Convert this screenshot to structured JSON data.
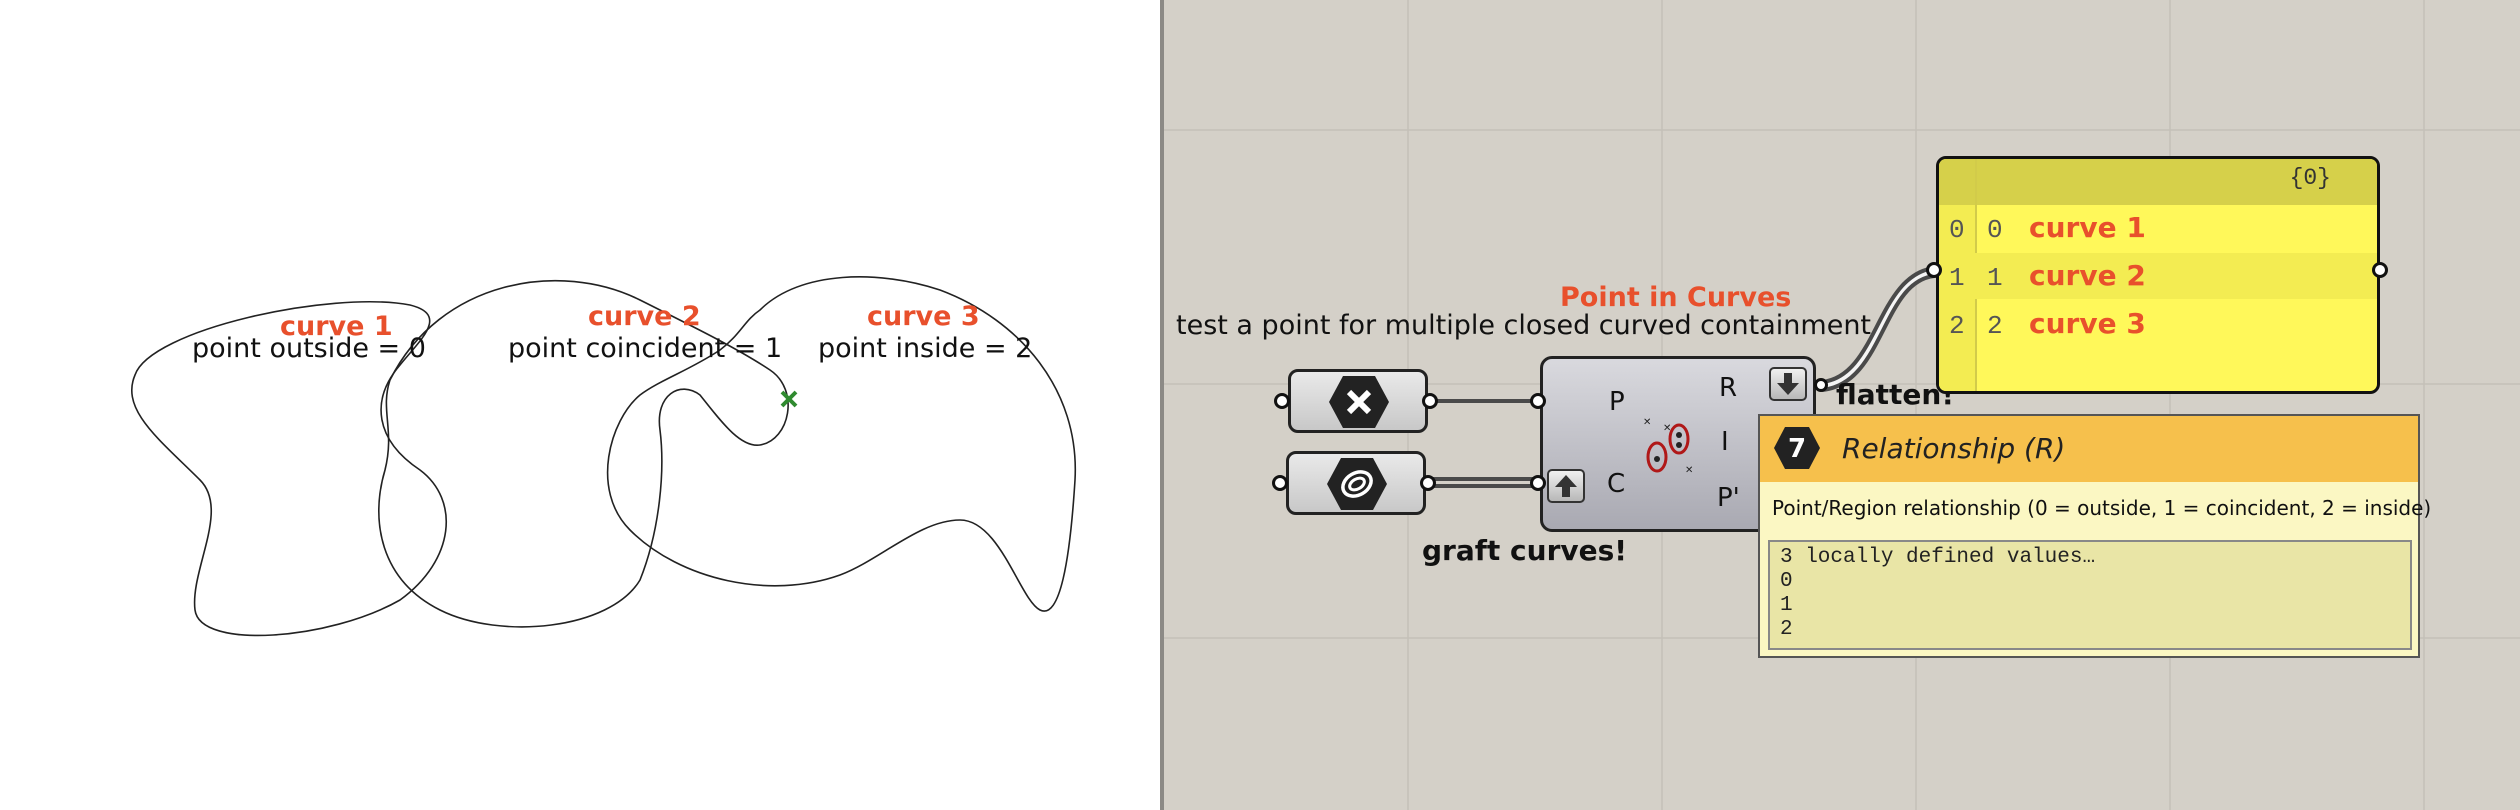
{
  "viewport": {
    "curve1": {
      "label": "curve 1",
      "sub": "point outside = 0"
    },
    "curve2": {
      "label": "curve 2",
      "sub": "point coincident = 1"
    },
    "curve3": {
      "label": "curve 3",
      "sub": "point inside = 2"
    },
    "colors": {
      "label": "#e8502c",
      "point": "#2f8a2f",
      "curve": "#222222"
    }
  },
  "canvas": {
    "group_title": "Point in Curves",
    "description": "test a point for multiple closed curved containment",
    "component": {
      "inputs": [
        "P",
        "C"
      ],
      "outputs": [
        "R",
        "I",
        "P'"
      ]
    },
    "flatten_label": "flatten!",
    "graft_label": "graft curves!",
    "panel": {
      "path": "{0}",
      "rows": [
        {
          "i": "0",
          "j": "0",
          "value": "curve 1"
        },
        {
          "i": "1",
          "j": "1",
          "value": "curve 2"
        },
        {
          "i": "2",
          "j": "2",
          "value": "curve 3"
        }
      ]
    },
    "tooltip": {
      "number": "7",
      "title": "Relationship (R)",
      "description": "Point/Region relationship (0 = outside, 1 = coincident, 2 = inside)",
      "values_header": "3 locally defined values…",
      "values": [
        "0",
        "1",
        "2"
      ]
    }
  }
}
